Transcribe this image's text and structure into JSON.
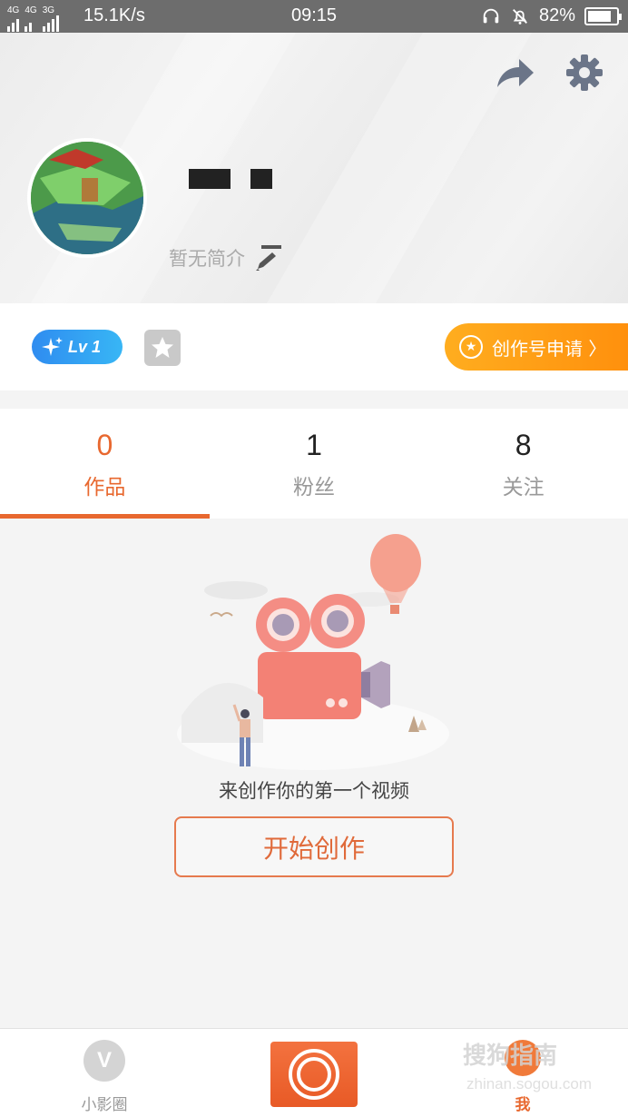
{
  "status_bar": {
    "network_left": "4G",
    "network_mid": "4G",
    "network_right": "3G",
    "speed": "15.1K/s",
    "time": "09:15",
    "battery": "82%",
    "battery_level": 0.82
  },
  "profile": {
    "bio": "暂无简介",
    "level": "Lv 1",
    "apply_label": "创作号申请 〉"
  },
  "tabs": [
    {
      "count": "0",
      "label": "作品",
      "active": true
    },
    {
      "count": "1",
      "label": "粉丝",
      "active": false
    },
    {
      "count": "8",
      "label": "关注",
      "active": false
    }
  ],
  "empty_state": {
    "message": "来创作你的第一个视频",
    "button_label": "开始创作"
  },
  "bottom_nav": {
    "circle_label": "小影圈",
    "me_label": "我"
  },
  "watermark": {
    "title": "搜狗指南",
    "url": "zhinan.sogou.com"
  },
  "colors": {
    "accent": "#e8682f",
    "apply_gradient_start": "#ffad1f",
    "level_blue": "#2f8cf0"
  }
}
